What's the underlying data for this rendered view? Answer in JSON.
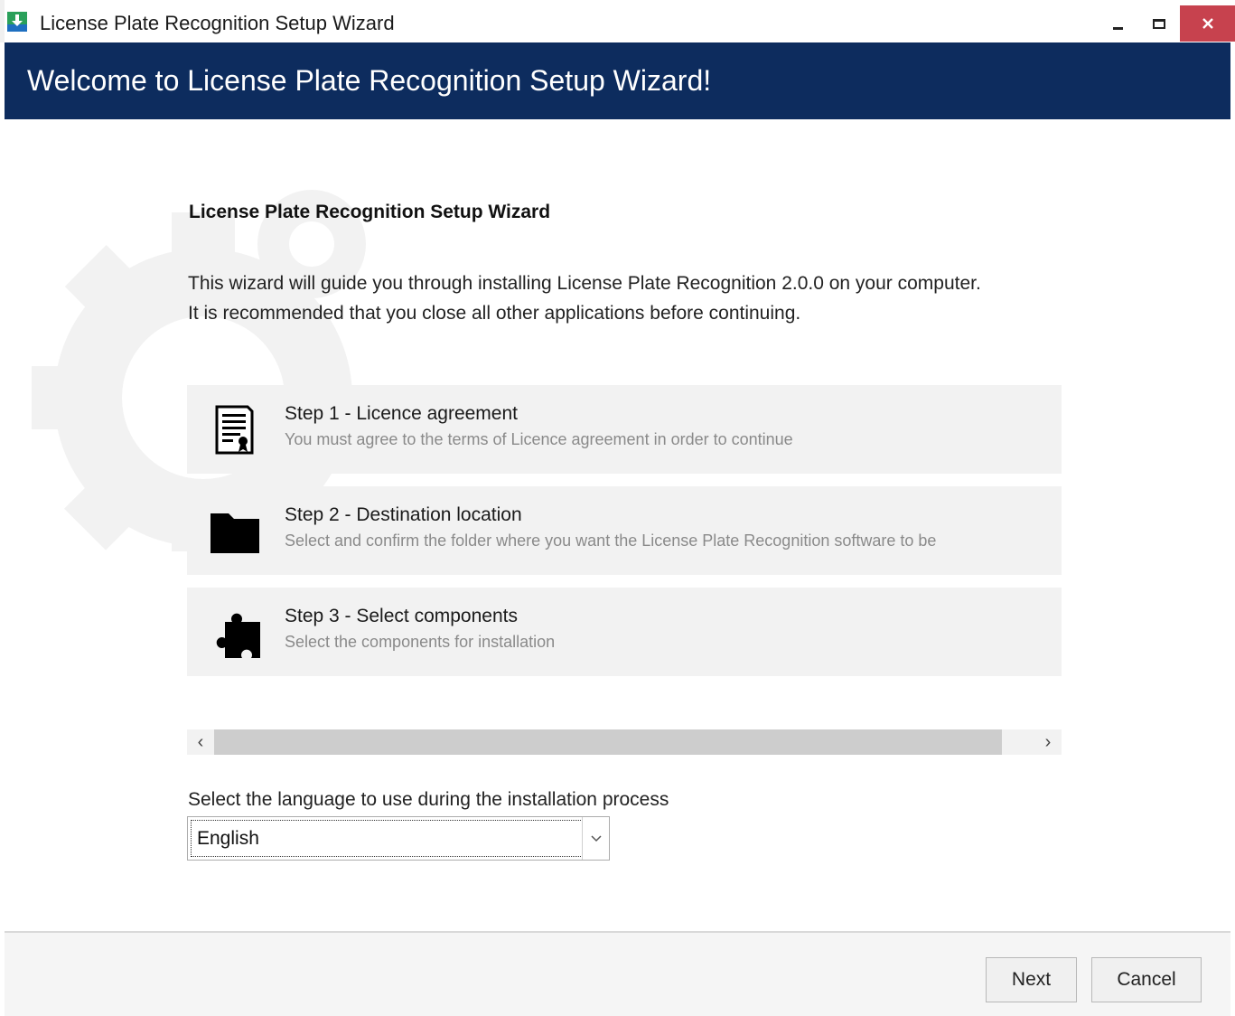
{
  "window": {
    "title": "License Plate Recognition Setup Wizard",
    "app_icon": "download-installer-icon",
    "controls": [
      "minimize-icon",
      "maximize-icon",
      "close-icon"
    ],
    "close_color": "#c7424e"
  },
  "header": {
    "heading": "Welcome to License Plate Recognition Setup Wizard!",
    "background": "#0d2c5e"
  },
  "main": {
    "title": "License Plate Recognition Setup Wizard",
    "intro_line1": "This wizard will guide you through installing License Plate Recognition 2.0.0 on your computer.",
    "intro_line2": "It is recommended that you close all other applications before continuing.",
    "steps": [
      {
        "icon": "document-certificate-icon",
        "title": "Step 1 - Licence agreement",
        "description": "You must agree to the terms of Licence agreement in order to continue"
      },
      {
        "icon": "folder-icon",
        "title": "Step 2 - Destination location",
        "description": "Select and confirm the folder where you want the License Plate Recognition software to be"
      },
      {
        "icon": "puzzle-icon",
        "title": "Step 3 - Select components",
        "description": "Select the components for installation"
      }
    ],
    "scrollbar": {
      "left_arrow": "‹",
      "right_arrow": "›"
    },
    "language": {
      "label": "Select the language to use during the installation process",
      "selected": "English"
    }
  },
  "footer": {
    "next_label": "Next",
    "cancel_label": "Cancel"
  }
}
